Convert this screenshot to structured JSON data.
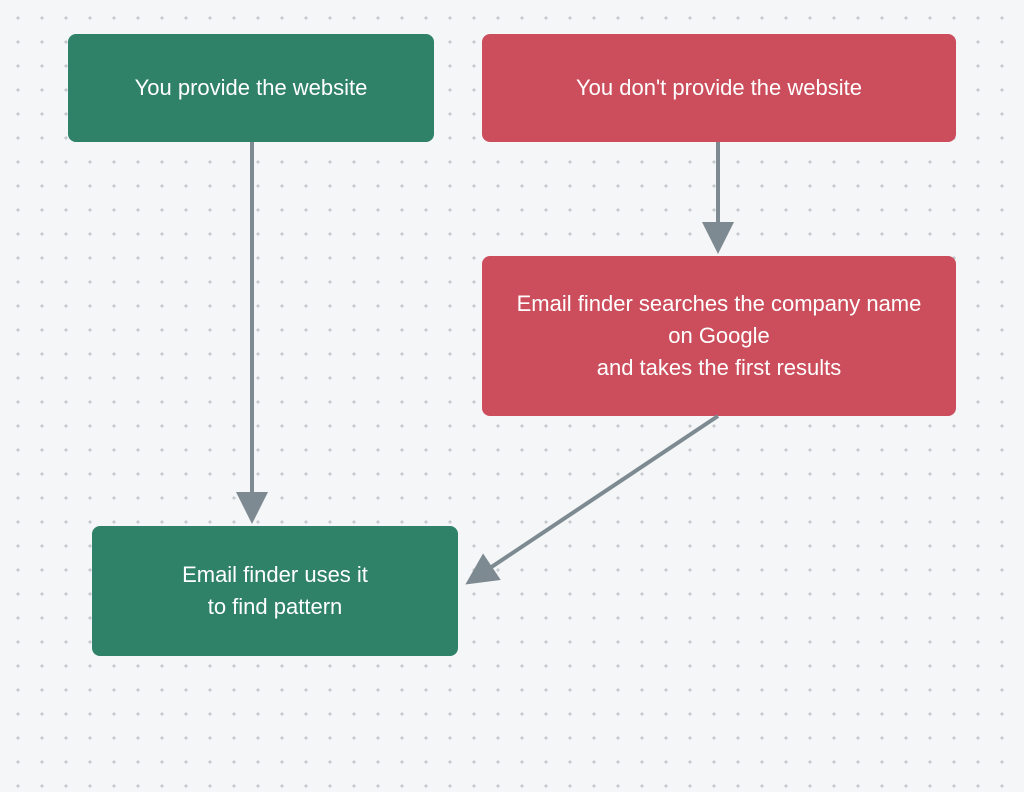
{
  "diagram": {
    "nodes": {
      "provide": {
        "label": "You provide the website",
        "color": "green"
      },
      "notprovide": {
        "label": "You don't provide the website",
        "color": "red"
      },
      "search": {
        "label": "Email finder searches the company name on Google\nand takes the first results",
        "color": "red"
      },
      "pattern": {
        "label": "Email finder uses it\nto find pattern",
        "color": "green"
      }
    },
    "edges": [
      {
        "from": "provide",
        "to": "pattern"
      },
      {
        "from": "notprovide",
        "to": "search"
      },
      {
        "from": "search",
        "to": "pattern"
      }
    ],
    "colors": {
      "green": "#2f8268",
      "red": "#cc4e5c",
      "arrow": "#7d8a92"
    }
  }
}
